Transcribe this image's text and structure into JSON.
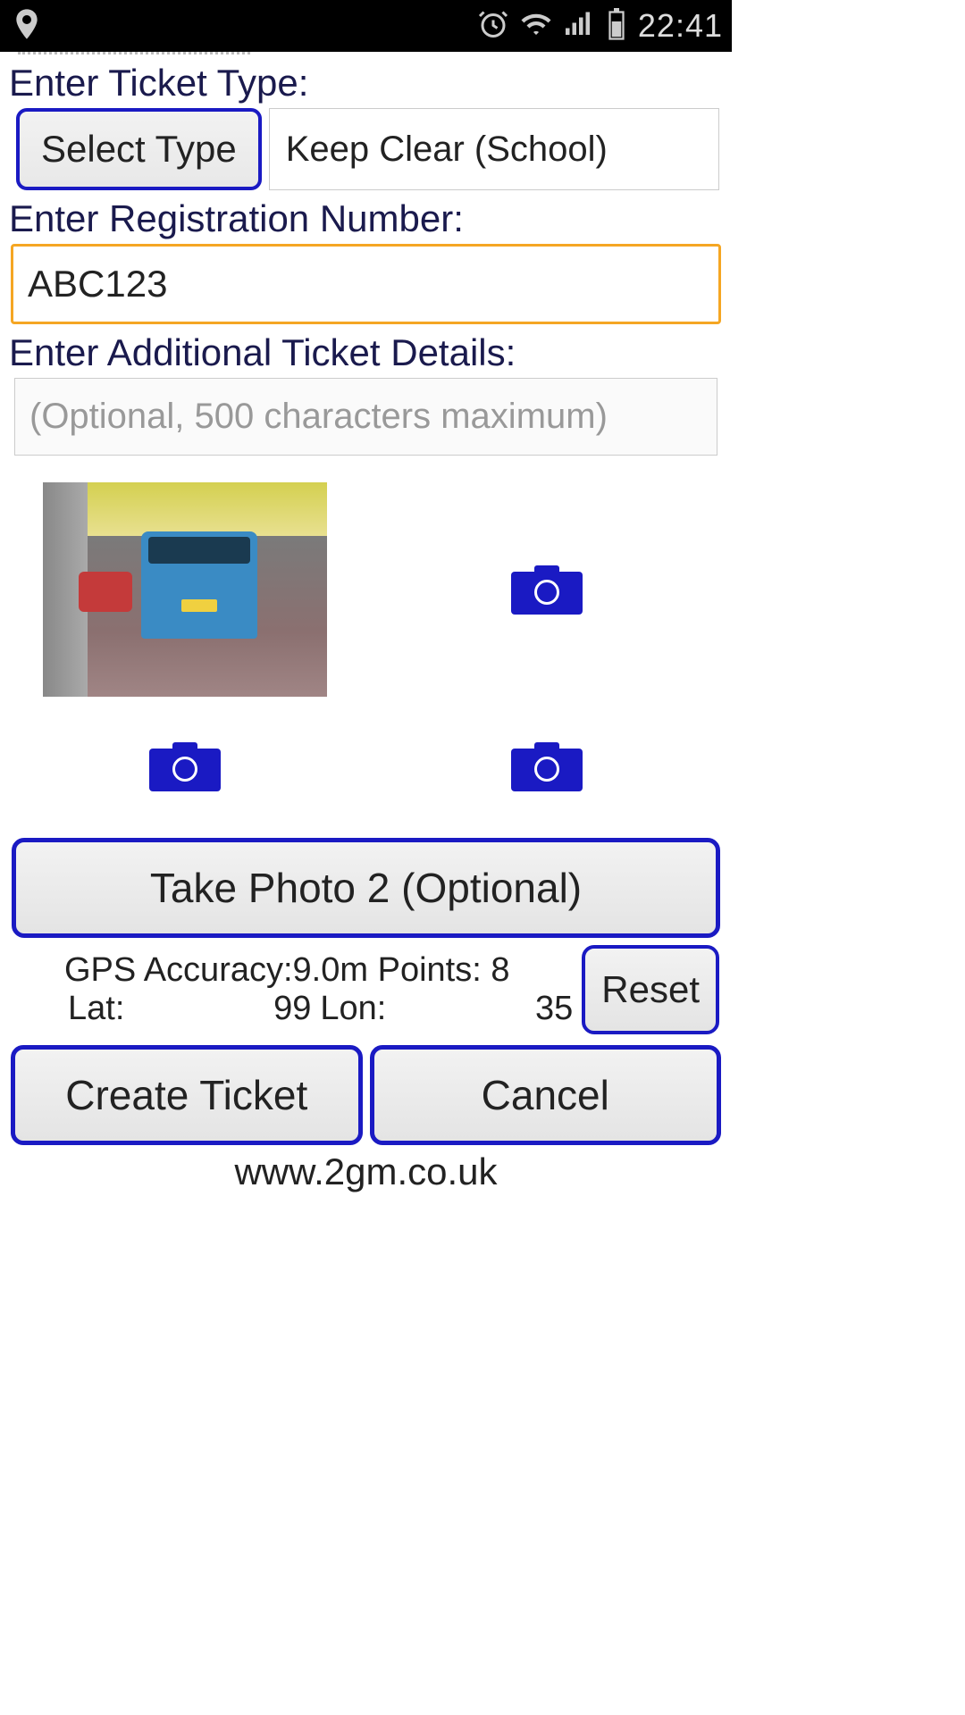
{
  "status_bar": {
    "time": "22:41"
  },
  "form": {
    "ticket_type_label": "Enter Ticket Type:",
    "select_type_button": "Select Type",
    "selected_type": "Keep Clear (School)",
    "registration_label": "Enter Registration Number:",
    "registration_value": "ABC123",
    "details_label": "Enter Additional Ticket Details:",
    "details_placeholder": "(Optional, 500 characters maximum)",
    "take_photo_button": "Take Photo 2 (Optional)"
  },
  "gps": {
    "accuracy_label": "GPS Accuracy:",
    "accuracy": "9.0m",
    "points_label": "Points:",
    "points": "8",
    "lat_label": "Lat:",
    "lat": "99",
    "lon_label": "Lon:",
    "lon": "35",
    "reset_button": "Reset"
  },
  "actions": {
    "create": "Create Ticket",
    "cancel": "Cancel"
  },
  "footer": {
    "url": "www.2gm.co.uk"
  }
}
